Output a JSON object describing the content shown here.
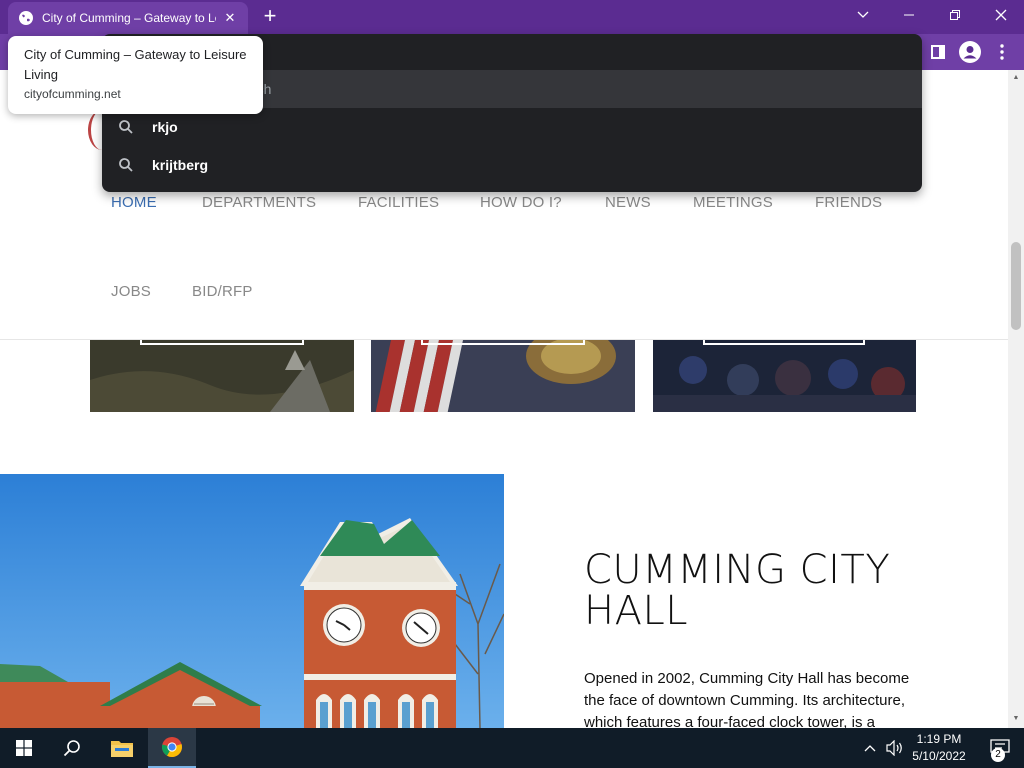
{
  "browser": {
    "tab_title": "City of Cumming – Gateway to Leisure Living",
    "tab_close": "✕",
    "new_tab": "+",
    "hover_card": {
      "title": "City of Cumming – Gateway to Leisure Living",
      "url": "cityofcumming.net"
    },
    "omnibox": {
      "placeholder": "rch",
      "suggestions": [
        {
          "text": "rkjo",
          "icon": "search-icon"
        },
        {
          "text": "krijtberg",
          "icon": "search-icon"
        }
      ]
    }
  },
  "site": {
    "nav": [
      {
        "label": "HOME",
        "active": true
      },
      {
        "label": "DEPARTMENTS"
      },
      {
        "label": "FACILITIES"
      },
      {
        "label": "HOW DO I?"
      },
      {
        "label": "NEWS"
      },
      {
        "label": "MEETINGS"
      },
      {
        "label": "FRIENDS"
      },
      {
        "label": "JOBS"
      },
      {
        "label": "BID/RFP"
      }
    ],
    "feature": {
      "title": "CUMMING CITY HALL",
      "body": "Opened in 2002, Cumming City Hall has become the face of downtown Cumming. Its architecture, which features a four-faced clock tower, is a"
    }
  },
  "taskbar": {
    "time": "1:19 PM",
    "date": "5/10/2022",
    "notifications": "2"
  },
  "colors": {
    "chrome_frame": "#5b2c91",
    "active_nav": "#3b6eb2",
    "taskbar": "#101c28"
  }
}
